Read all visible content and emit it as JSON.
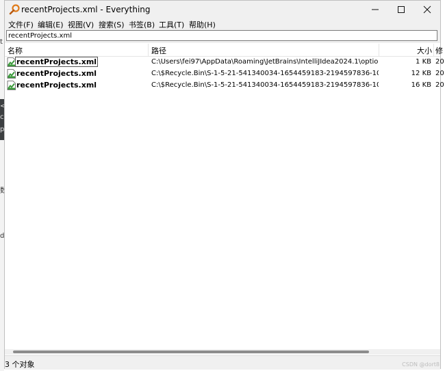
{
  "window": {
    "title": "recentProjects.xml - Everything"
  },
  "menu": [
    "文件(F)",
    "编辑(E)",
    "视图(V)",
    "搜索(S)",
    "书签(B)",
    "工具(T)",
    "帮助(H)"
  ],
  "search": {
    "value": "recentProjects.xml"
  },
  "columns": {
    "name": "名称",
    "path": "路径",
    "size": "大小",
    "modified": "修"
  },
  "rows": [
    {
      "name": "recentProjects.xml",
      "path": "C:\\Users\\fei97\\AppData\\Roaming\\JetBrains\\IntelliJIdea2024.1\\optio...",
      "size": "1 KB",
      "date": "20"
    },
    {
      "name": "recentProjects.xml",
      "path": "C:\\$Recycle.Bin\\S-1-5-21-541340034-1654459183-2194597836-100...",
      "size": "12 KB",
      "date": "20"
    },
    {
      "name": "recentProjects.xml",
      "path": "C:\\$Recycle.Bin\\S-1-5-21-541340034-1654459183-2194597836-100...",
      "size": "16 KB",
      "date": "20"
    }
  ],
  "status": {
    "text": "3 个对象"
  },
  "watermark": "CSDN @dort8",
  "background_glyphs": [
    "t",
    "<",
    "c",
    "p",
    "数",
    "d"
  ],
  "colors": {
    "titlebar": "#f0f0f0",
    "icon_orange": "#e07b1a",
    "file_green": "#3c9a3c"
  }
}
